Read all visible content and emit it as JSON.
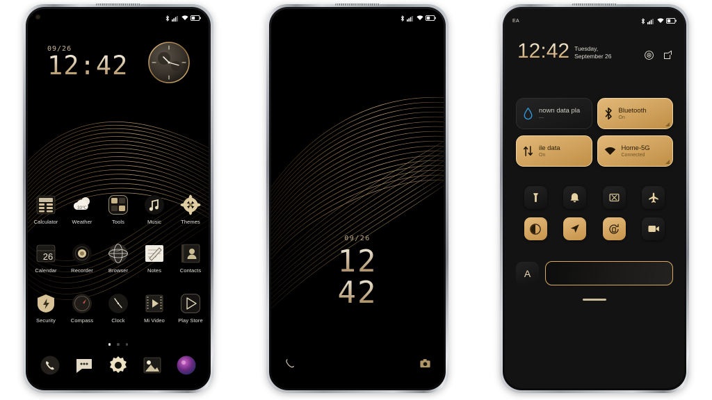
{
  "meta": {
    "theme_accent": "#d4a257",
    "screen_bg": "#000000",
    "frame_color": "#b9bcc2"
  },
  "phone1": {
    "statusbar": {
      "icons": [
        "bluetooth-icon",
        "signal-icon",
        "wifi-icon",
        "battery-icon"
      ]
    },
    "widget": {
      "date": "09/26",
      "time": "12:42",
      "analog_clock": "analog-clock-widget"
    },
    "apps": [
      {
        "label": "Calculator",
        "icon": "calculator-icon"
      },
      {
        "label": "Weather",
        "icon": "weather-icon",
        "badge": "33℃"
      },
      {
        "label": "Tools",
        "icon": "tools-folder-icon"
      },
      {
        "label": "Music",
        "icon": "music-icon"
      },
      {
        "label": "Themes",
        "icon": "themes-icon"
      },
      {
        "label": "Calendar",
        "icon": "calendar-icon",
        "badge": "26"
      },
      {
        "label": "Recorder",
        "icon": "recorder-icon"
      },
      {
        "label": "Browser",
        "icon": "browser-icon"
      },
      {
        "label": "Notes",
        "icon": "notes-icon"
      },
      {
        "label": "Contacts",
        "icon": "contacts-icon"
      },
      {
        "label": "Security",
        "icon": "security-icon"
      },
      {
        "label": "Compass",
        "icon": "compass-icon"
      },
      {
        "label": "Clock",
        "icon": "clock-icon"
      },
      {
        "label": "Mi Video",
        "icon": "mi-video-icon"
      },
      {
        "label": "Play Store",
        "icon": "play-store-icon"
      }
    ],
    "page_dots": {
      "total": 3,
      "active": 1
    },
    "dock": [
      {
        "icon": "phone-icon"
      },
      {
        "icon": "messages-icon"
      },
      {
        "icon": "settings-icon"
      },
      {
        "icon": "gallery-icon"
      },
      {
        "icon": "camera-icon"
      }
    ]
  },
  "phone2": {
    "statusbar": {
      "icons": [
        "bluetooth-icon",
        "signal-icon",
        "wifi-icon",
        "battery-icon"
      ]
    },
    "lock": {
      "date": "09/26",
      "hours": "12",
      "minutes": "42"
    },
    "shortcuts": [
      {
        "icon": "phone-shortcut-icon"
      },
      {
        "icon": "camera-shortcut-icon"
      }
    ]
  },
  "phone3": {
    "statusbar": {
      "carrier": "EA",
      "icons": [
        "bluetooth-icon",
        "signal-icon",
        "wifi-icon",
        "battery-icon"
      ]
    },
    "header": {
      "time": "12:42",
      "day": "Tuesday,",
      "date": "September 26",
      "actions": [
        "settings-gear-icon",
        "edit-icon"
      ]
    },
    "tiles": [
      {
        "title": "nown data pla",
        "subtitle": "—",
        "icon": "data-usage-icon",
        "state": "off"
      },
      {
        "title": "Bluetooth",
        "subtitle": "On",
        "icon": "bluetooth-icon",
        "state": "on"
      },
      {
        "title": "ile data",
        "subtitle": "On",
        "icon": "mobile-data-icon",
        "state": "on"
      },
      {
        "title": "Home-5G",
        "subtitle": "Connected",
        "icon": "wifi-icon",
        "state": "on"
      }
    ],
    "quick_icons_row1": [
      {
        "icon": "flashlight-icon",
        "state": "off"
      },
      {
        "icon": "bell-icon",
        "state": "off"
      },
      {
        "icon": "screenshot-icon",
        "state": "off"
      },
      {
        "icon": "airplane-icon",
        "state": "off"
      }
    ],
    "quick_icons_row2": [
      {
        "icon": "dark-mode-icon",
        "state": "on"
      },
      {
        "icon": "location-icon",
        "state": "on"
      },
      {
        "icon": "auto-rotate-icon",
        "state": "on"
      },
      {
        "icon": "screen-record-icon",
        "state": "off"
      }
    ],
    "brightness": {
      "auto_label": "A",
      "icon": "auto-brightness-icon",
      "value": 0
    },
    "home_indicator": "home-indicator-bar"
  }
}
